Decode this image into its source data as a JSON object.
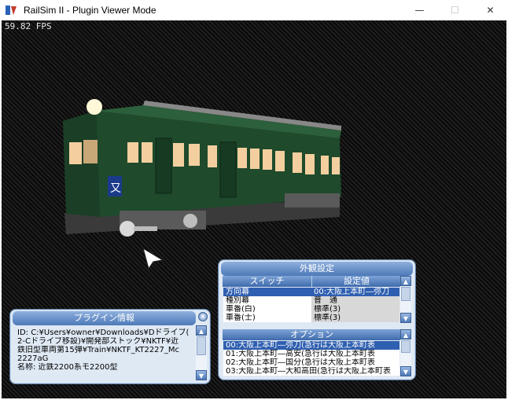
{
  "window": {
    "title": "RailSim II - Plugin Viewer Mode",
    "minimize_glyph": "—",
    "maximize_glyph": "☐",
    "close_glyph": "✕"
  },
  "viewport": {
    "fps": "59.82 FPS"
  },
  "appearance_panel": {
    "title": "外観設定",
    "col_switch": "スイッチ",
    "col_value": "設定値",
    "rows": [
      {
        "switch": "方向幕",
        "value": "00:大阪上本町―弥刀"
      },
      {
        "switch": "種別幕",
        "value": "普　通"
      },
      {
        "switch": "車番(白)",
        "value": "標準(3)"
      },
      {
        "switch": "車番(士)",
        "value": "標準(3)"
      }
    ],
    "options_title": "オプション",
    "options": [
      "00:大阪上本町―弥刀(急行は大阪上本町表",
      "01:大阪上本町―高安(急行は大阪上本町表",
      "02:大阪上本町―国分(急行は大阪上本町表",
      "03:大阪上本町―大和高田(急行は大阪上本町表"
    ]
  },
  "plugin_panel": {
    "title": "プラグイン情報",
    "lines": [
      "ID: C:¥Users¥owner¥Downloads¥Dドライブ(",
      "2-Cドライブ移設)¥開発部ストック¥NKTF¥近",
      "鉄旧型車両第15弾¥Train¥NKTF_KT2227_Mc",
      "2227aG",
      "名称: 近鉄2200系モ2200型"
    ]
  },
  "colors": {
    "train_body": "#1f4a2c",
    "window_glow": "#f3cfa0",
    "panel_accent": "#4d79b8"
  }
}
